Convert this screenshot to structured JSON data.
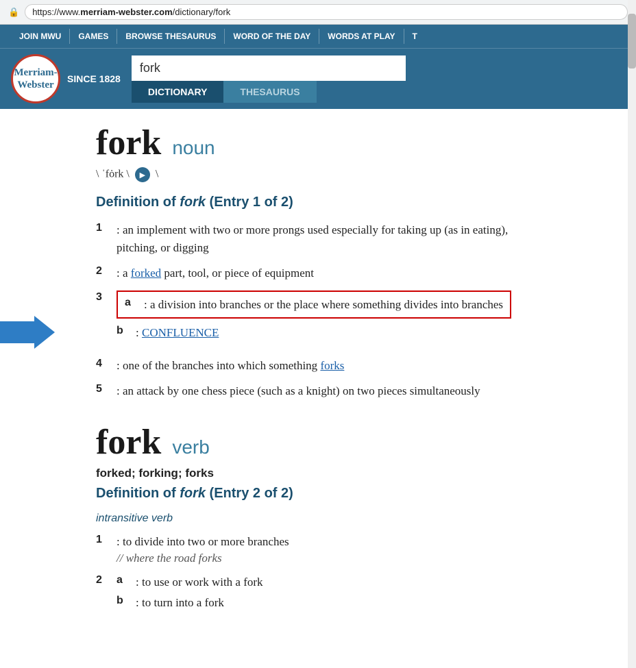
{
  "browser": {
    "url": "https://www.merriam-webster.com/dictionary/fork",
    "url_domain": "merriam-webster.com",
    "url_path": "/dictionary/fork"
  },
  "nav": {
    "items": [
      "JOIN MWU",
      "GAMES",
      "BROWSE THESAURUS",
      "WORD OF THE DAY",
      "WORDS AT PLAY",
      "T"
    ]
  },
  "logo": {
    "line1": "Merriam-",
    "line2": "Webster",
    "since": "SINCE 1828"
  },
  "search": {
    "value": "fork",
    "tab_active": "DICTIONARY",
    "tab_inactive": "THESAURUS"
  },
  "entry1": {
    "word": "fork",
    "pos": "noun",
    "pronunciation": "\\ ˈfȯrk \\",
    "def_heading": "Definition of fork (Entry 1 of 2)",
    "definitions": [
      {
        "number": "1",
        "text": ": an implement with two or more prongs used especially for taking up (as in eating), pitching, or digging"
      },
      {
        "number": "2",
        "text": ": a forked part, tool, or piece of equipment"
      }
    ],
    "def3a": ": a division into branches or the place where something divides into branches",
    "def3b_prefix": ": ",
    "def3b_link": "CONFLUENCE",
    "def4": ": one of the branches into which something forks",
    "def5": ": an attack by one chess piece (such as a knight) on two pieces simultaneously"
  },
  "entry2": {
    "word": "fork",
    "pos": "verb",
    "forms": "forked; forking; forks",
    "def_heading": "Definition of fork (Entry 2 of 2)",
    "intransitive_label": "intransitive verb",
    "def1": ": to divide into two or more branches",
    "def1_example": "// where the road forks",
    "def2a": ": to use or work with a fork",
    "def2b": ": to turn into a fork"
  },
  "arrow": {
    "visible": true
  }
}
